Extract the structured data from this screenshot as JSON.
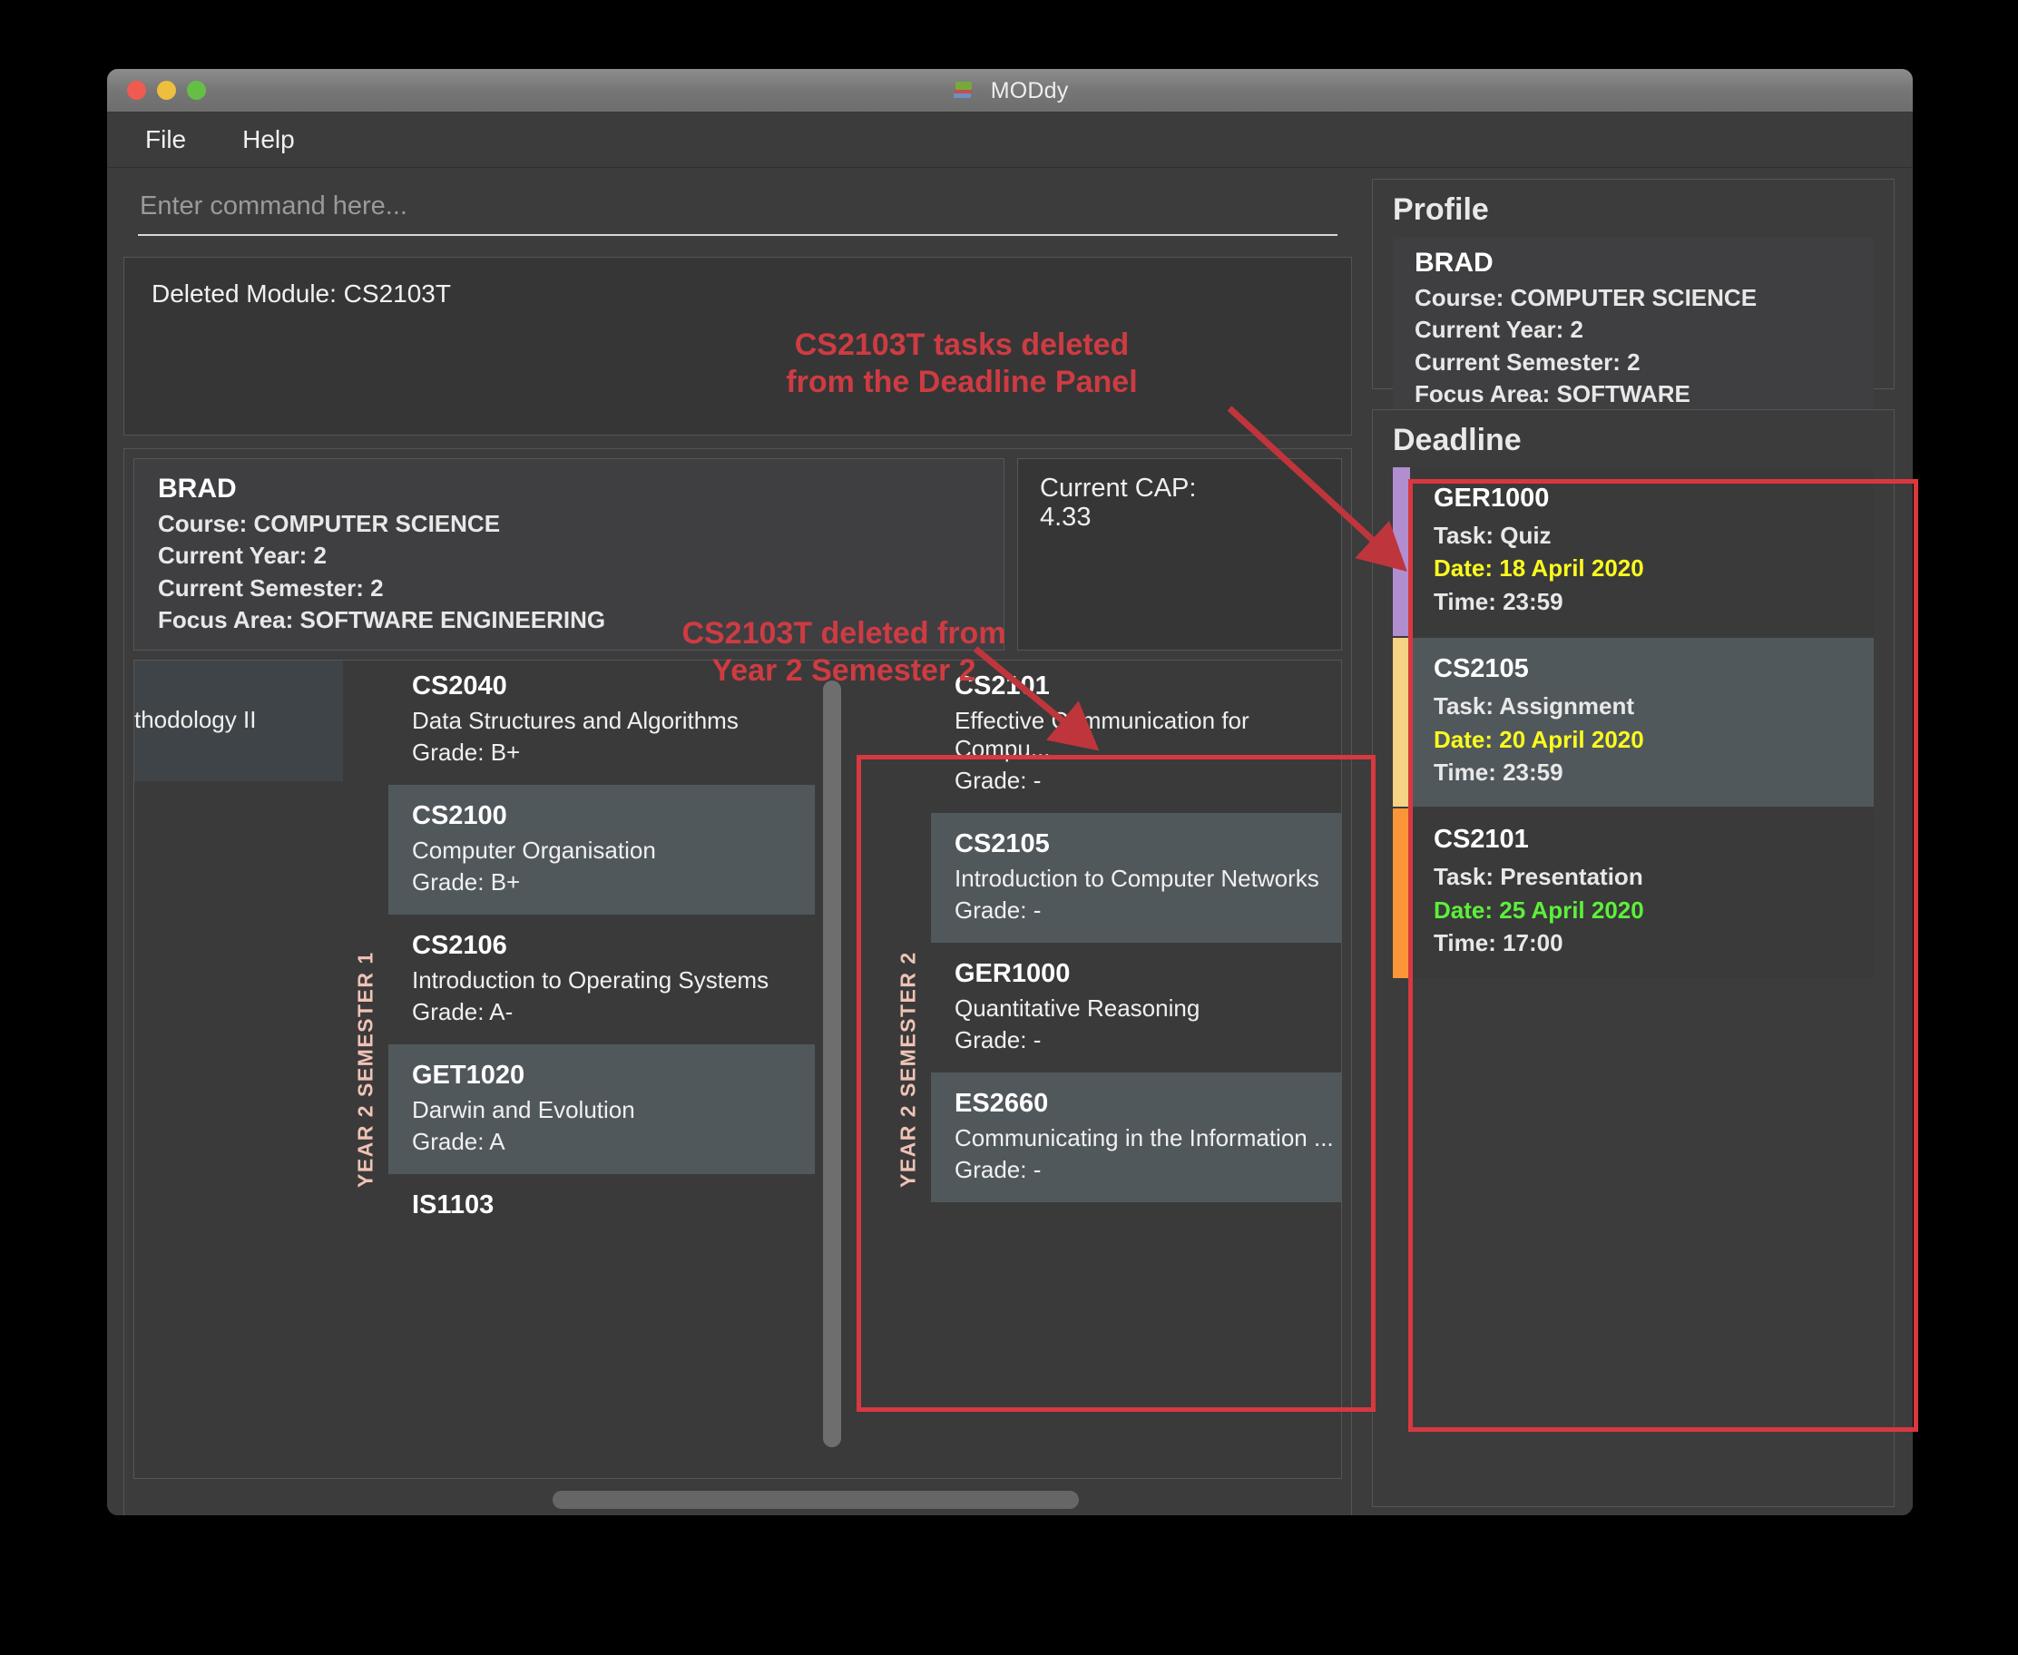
{
  "window": {
    "title": "MODdy",
    "app_icon": "books-icon",
    "traffic_lights": [
      "close",
      "minimize",
      "maximize"
    ]
  },
  "menubar": {
    "items": [
      {
        "label": "File"
      },
      {
        "label": "Help"
      }
    ]
  },
  "command": {
    "placeholder": "Enter command here...",
    "value": ""
  },
  "result": {
    "text": "Deleted Module: CS2103T"
  },
  "profile_main": {
    "name": "BRAD",
    "course": "Course: COMPUTER SCIENCE",
    "year": "Current Year: 2",
    "semester": "Current Semester: 2",
    "focus": "Focus Area: SOFTWARE ENGINEERING"
  },
  "cap": {
    "label": "Current CAP:",
    "value": "4.33"
  },
  "modules": {
    "clipped_column": {
      "partial_title": "thodology II"
    },
    "semester1": {
      "label": "YEAR 2 SEMESTER 1",
      "items": [
        {
          "code": "CS2040",
          "title": "Data Structures and Algorithms",
          "grade": "Grade: B+"
        },
        {
          "code": "CS2100",
          "title": "Computer Organisation",
          "grade": "Grade: B+"
        },
        {
          "code": "CS2106",
          "title": "Introduction to Operating Systems",
          "grade": "Grade: A-"
        },
        {
          "code": "GET1020",
          "title": "Darwin and Evolution",
          "grade": "Grade: A"
        },
        {
          "code": "IS1103",
          "title": "",
          "grade": ""
        }
      ]
    },
    "semester2": {
      "label": "YEAR 2 SEMESTER 2",
      "items": [
        {
          "code": "CS2101",
          "title": "Effective Communication for Compu...",
          "grade": "Grade: -"
        },
        {
          "code": "CS2105",
          "title": "Introduction to Computer Networks",
          "grade": "Grade: -"
        },
        {
          "code": "GER1000",
          "title": "Quantitative Reasoning",
          "grade": "Grade: -"
        },
        {
          "code": "ES2660",
          "title": "Communicating in the Information ...",
          "grade": "Grade: -"
        }
      ]
    }
  },
  "profile_panel": {
    "title": "Profile",
    "name": "BRAD",
    "course": "Course: COMPUTER SCIENCE",
    "year": "Current Year: 2",
    "semester": "Current Semester: 2",
    "focus": "Focus Area: SOFTWARE ENGINEERING"
  },
  "deadline_panel": {
    "title": "Deadline",
    "items": [
      {
        "code": "GER1000",
        "task": "Task: Quiz",
        "date": "Date: 18 April 2020",
        "time": "Time: 23:59",
        "bar_color": "#b18ed0",
        "date_color": "#fbfb1e"
      },
      {
        "code": "CS2105",
        "task": "Task: Assignment",
        "date": "Date: 20 April 2020",
        "time": "Time: 23:59",
        "bar_color": "#f5d284",
        "date_color": "#fbfb1e"
      },
      {
        "code": "CS2101",
        "task": "Task: Presentation",
        "date": "Date: 25 April 2020",
        "time": "Time: 17:00",
        "bar_color": "#fb9638",
        "date_color": "#5cf03a"
      }
    ]
  },
  "annotations": {
    "deadline_note": "CS2103T tasks deleted\nfrom the Deadline Panel",
    "semester_note": "CS2103T deleted from\nYear 2 Semester 2",
    "highlight_color": "#d8383f"
  }
}
